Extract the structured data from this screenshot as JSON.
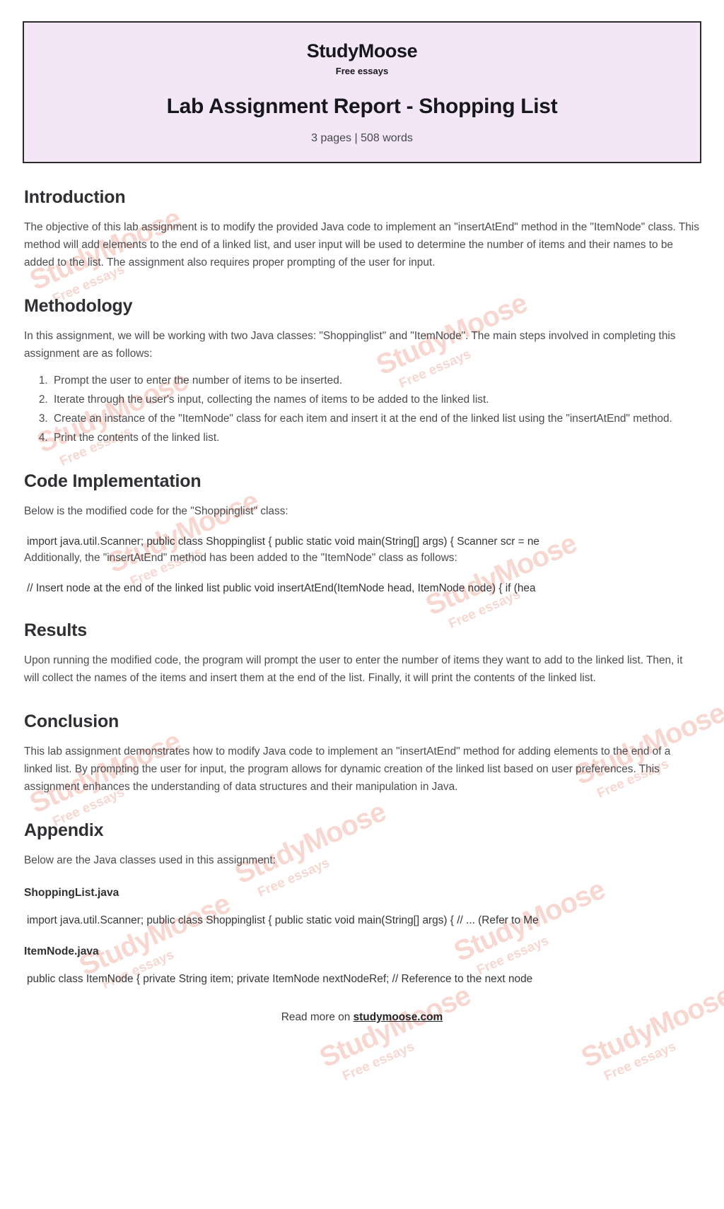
{
  "header": {
    "brand": "StudyMoose",
    "brand_tagline": "Free essays",
    "title": "Lab Assignment Report - Shopping List",
    "meta": "3 pages | 508 words",
    "bg_color": "#f3e7f7",
    "border_color": "#2b2b2b"
  },
  "sections": {
    "introduction": {
      "heading": "Introduction",
      "paragraph": "The objective of this lab assignment is to modify the provided Java code to implement an \"insertAtEnd\" method in the \"ItemNode\" class. This method will add elements to the end of a linked list, and user input will be used to determine the number of items and their names to be added to the list. The assignment also requires proper prompting of the user for input."
    },
    "methodology": {
      "heading": "Methodology",
      "paragraph": "In this assignment, we will be working with two Java classes: \"Shoppinglist\" and \"ItemNode\". The main steps involved in completing this assignment are as follows:",
      "steps": [
        "Prompt the user to enter the number of items to be inserted.",
        "Iterate through the user's input, collecting the names of items to be added to the linked list.",
        "Create an instance of the \"ItemNode\" class for each item and insert it at the end of the linked list using the \"insertAtEnd\" method.",
        "Print the contents of the linked list."
      ]
    },
    "code_implementation": {
      "heading": "Code Implementation",
      "paragraph_1": "Below is the modified code for the \"Shoppinglist\" class:",
      "code_1": "import java.util.Scanner; public class Shoppinglist { public static void main(String[] args) { Scanner scr = ne",
      "paragraph_2": "Additionally, the \"insertAtEnd\" method has been added to the \"ItemNode\" class as follows:",
      "code_2": "// Insert node at the end of the linked list public void insertAtEnd(ItemNode head, ItemNode node) { if (hea"
    },
    "results": {
      "heading": "Results",
      "paragraph": "Upon running the modified code, the program will prompt the user to enter the number of items they want to add to the linked list. Then, it will collect the names of the items and insert them at the end of the list. Finally, it will print the contents of the linked list."
    },
    "conclusion": {
      "heading": "Conclusion",
      "paragraph": "This lab assignment demonstrates how to modify Java code to implement an \"insertAtEnd\" method for adding elements to the end of a linked list. By prompting the user for input, the program allows for dynamic creation of the linked list based on user preferences. This assignment enhances the understanding of data structures and their manipulation in Java."
    },
    "appendix": {
      "heading": "Appendix",
      "paragraph": "Below are the Java classes used in this assignment:",
      "file_1_name": "ShoppingList.java",
      "file_1_code": "import java.util.Scanner; public class Shoppinglist { public static void main(String[] args) { // ... (Refer to Me",
      "file_2_name": "ItemNode.java",
      "file_2_code": "public class ItemNode { private String item; private ItemNode nextNodeRef; // Reference to the next node"
    }
  },
  "footer": {
    "prefix": "Read more on ",
    "link": "studymoose.com"
  },
  "watermark": {
    "main": "StudyMoose",
    "sub": "Free essays",
    "color": "#f3b7ab"
  }
}
